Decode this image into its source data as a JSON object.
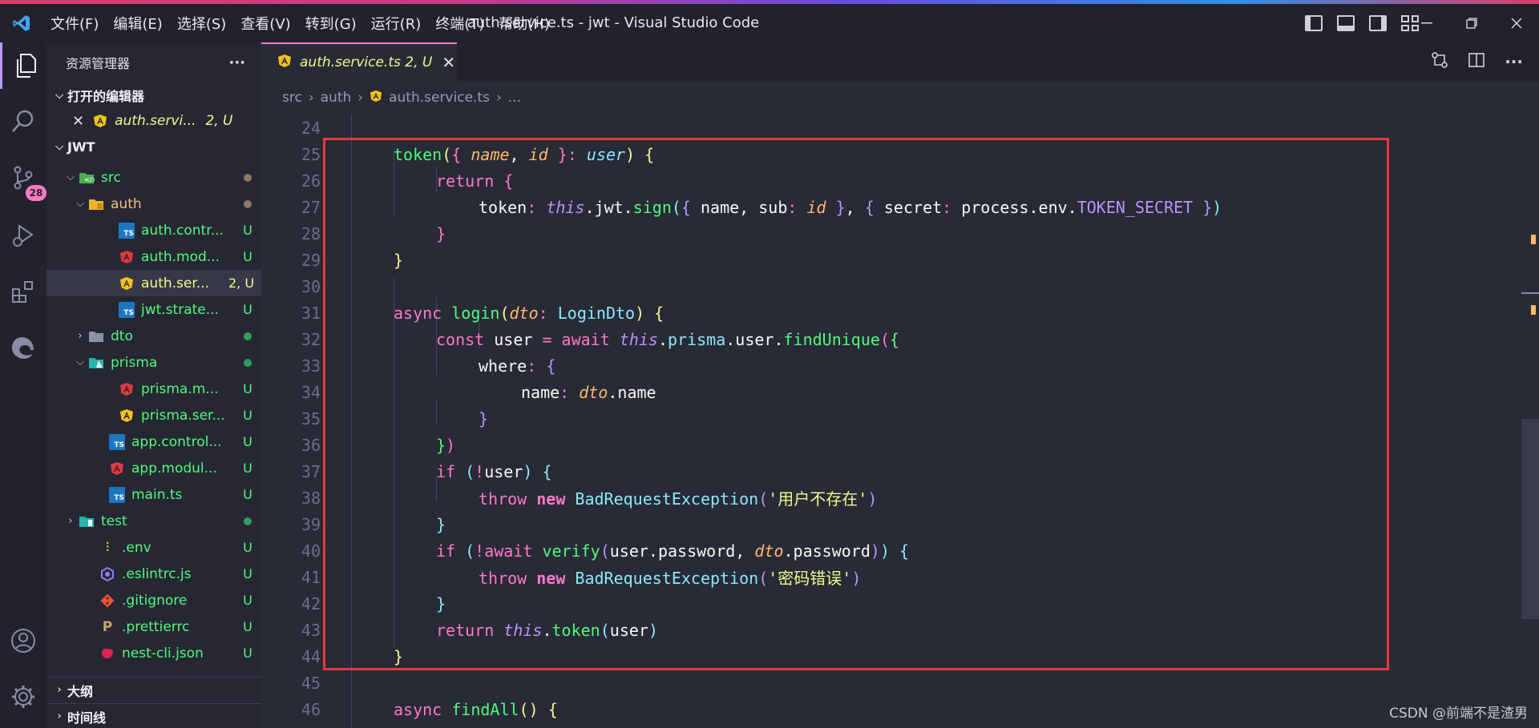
{
  "titlebar": {
    "menu": [
      "文件(F)",
      "编辑(E)",
      "选择(S)",
      "查看(V)",
      "转到(G)",
      "运行(R)",
      "终端(T)",
      "帮助(H)"
    ],
    "window_title": "auth.service.ts - jwt - Visual Studio Code"
  },
  "activity": {
    "scm_badge": "28"
  },
  "sidebar": {
    "title": "资源管理器",
    "more": "···",
    "open_editors_title": "打开的编辑器",
    "open_editor_item": {
      "name": "auth.servi...",
      "status": "2, U"
    },
    "project_title": "JWT",
    "tree": [
      {
        "name": "src",
        "status": ""
      },
      {
        "name": "auth",
        "status": ""
      },
      {
        "name": "auth.contr...",
        "status": "U"
      },
      {
        "name": "auth.mod...",
        "status": "U"
      },
      {
        "name": "auth.ser...",
        "status": "2, U"
      },
      {
        "name": "jwt.strate...",
        "status": "U"
      },
      {
        "name": "dto",
        "status": ""
      },
      {
        "name": "prisma",
        "status": ""
      },
      {
        "name": "prisma.m...",
        "status": "U"
      },
      {
        "name": "prisma.ser...",
        "status": "U"
      },
      {
        "name": "app.control...",
        "status": "U"
      },
      {
        "name": "app.modul...",
        "status": "U"
      },
      {
        "name": "main.ts",
        "status": "U"
      },
      {
        "name": "test",
        "status": ""
      },
      {
        "name": ".env",
        "status": "U"
      },
      {
        "name": ".eslintrc.js",
        "status": "U"
      },
      {
        "name": ".gitignore",
        "status": "U"
      },
      {
        "name": ".prettierrc",
        "status": "U"
      },
      {
        "name": "nest-cli.json",
        "status": "U"
      }
    ],
    "outline_title": "大纲",
    "timeline_title": "时间线"
  },
  "editor": {
    "tab_label": "auth.service.ts 2, U",
    "breadcrumb": [
      "src",
      "auth",
      "auth.service.ts",
      "..."
    ],
    "line_numbers": [
      "24",
      "25",
      "26",
      "27",
      "28",
      "29",
      "30",
      "31",
      "32",
      "33",
      "34",
      "35",
      "36",
      "37",
      "38",
      "39",
      "40",
      "41",
      "42",
      "43",
      "44",
      "45",
      "46"
    ],
    "strings": {
      "user_not_exist": "'用户不存在'",
      "password_wrong": "'密码错误'"
    }
  },
  "watermark": "CSDN @前端不是渣男",
  "colors": {
    "accent": "#ff79c6",
    "highlight_box": "#e23b3b",
    "background": "#282a36"
  }
}
